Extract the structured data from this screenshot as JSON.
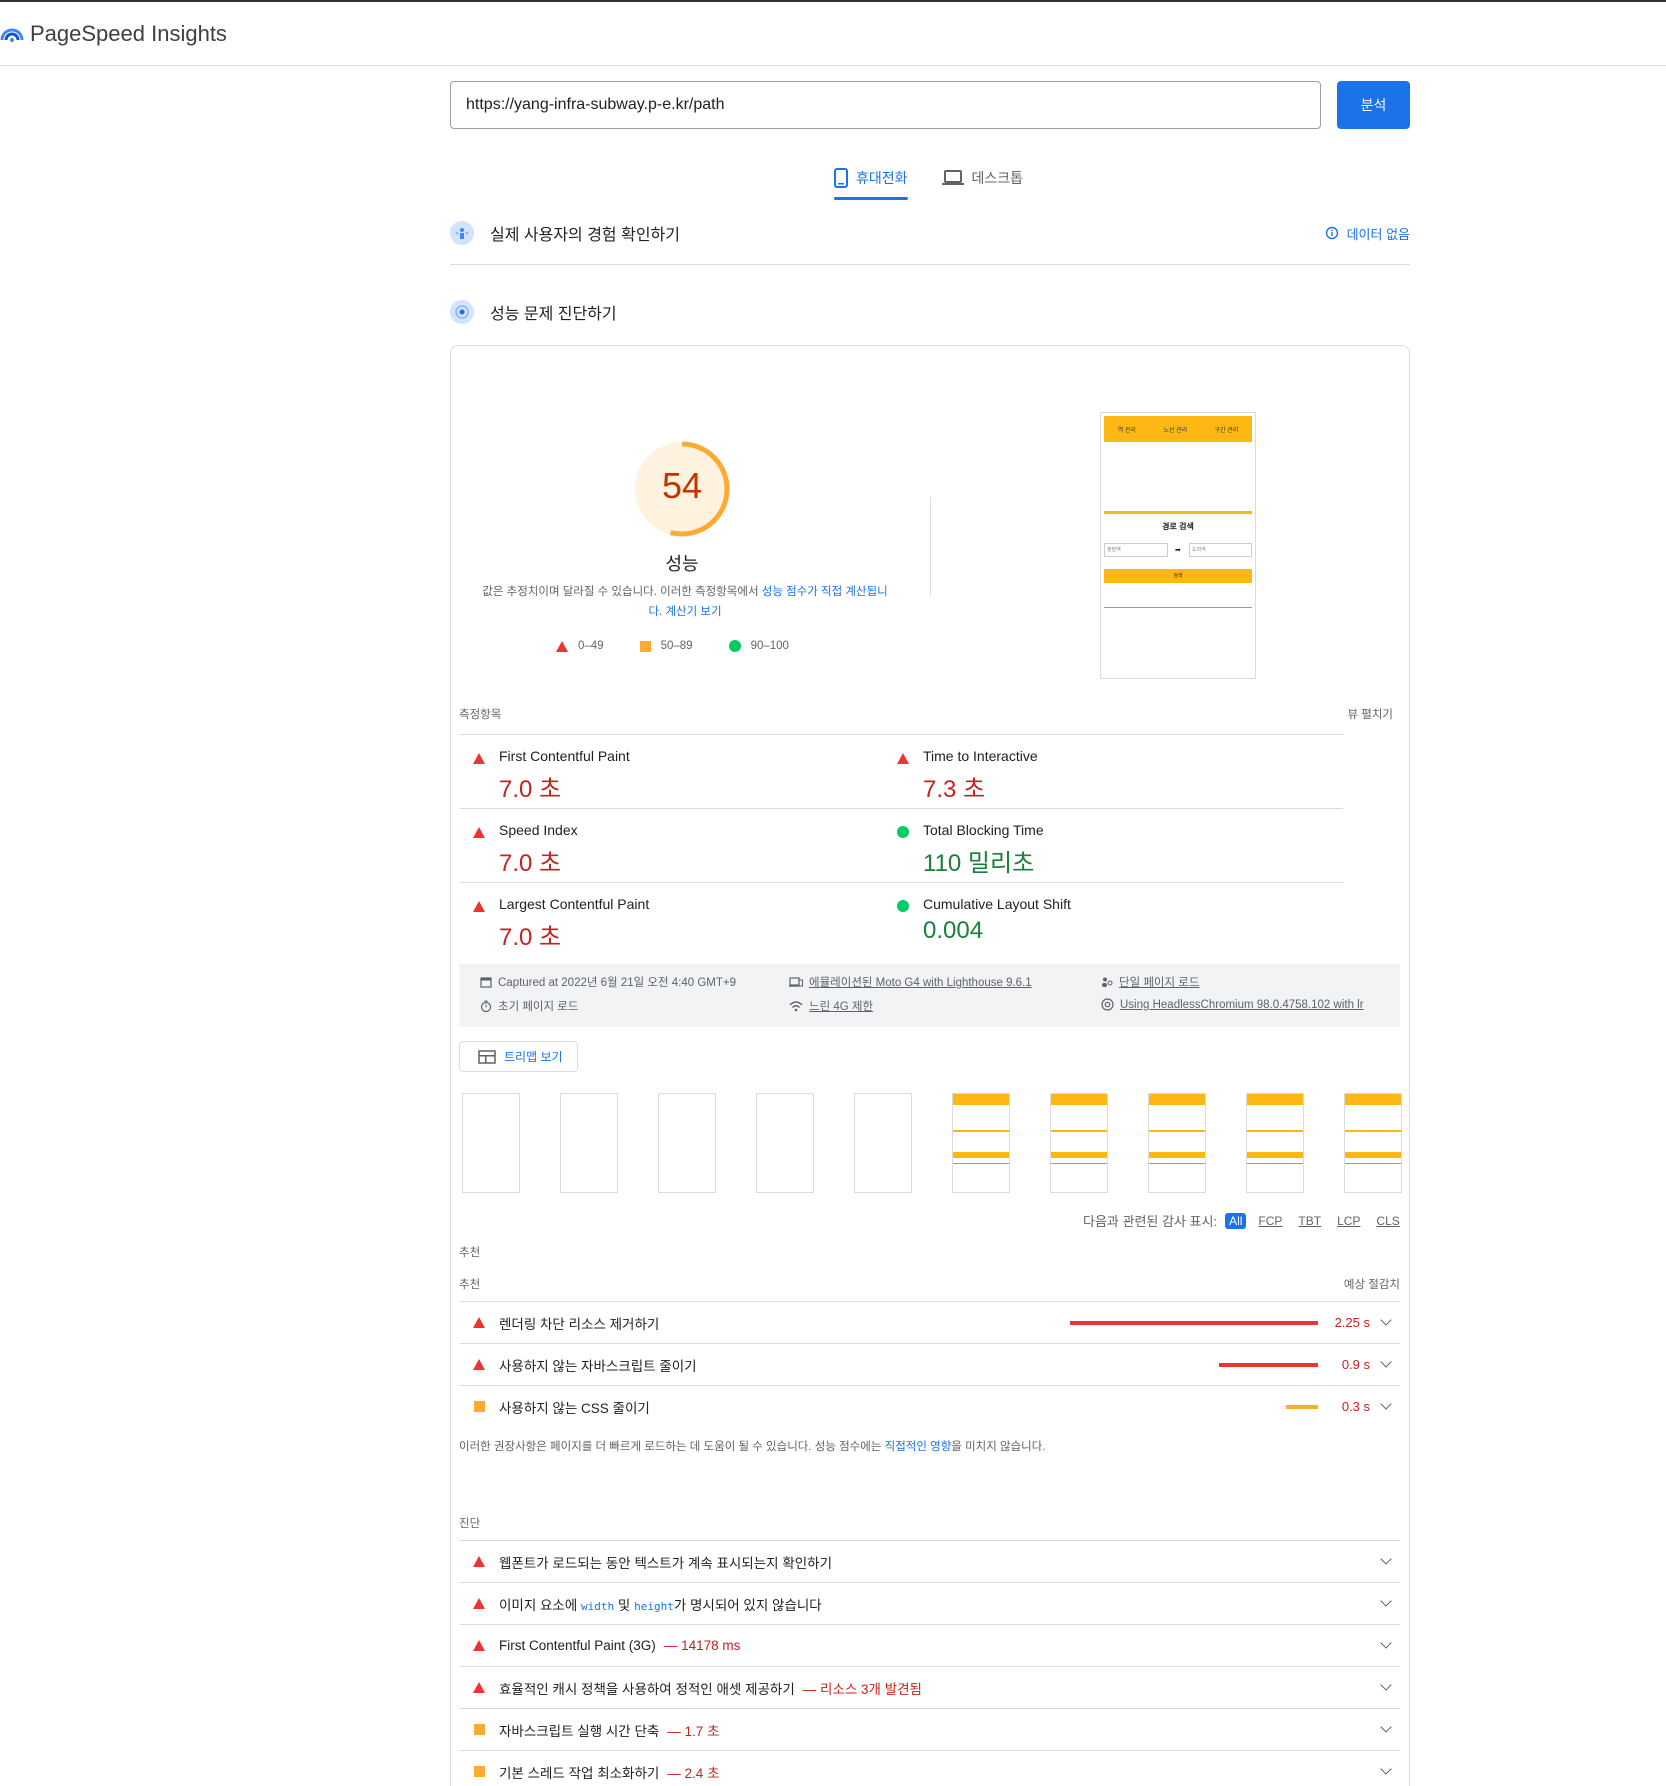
{
  "header": {
    "brand": "PageSpeed Insights"
  },
  "search": {
    "url": "https://yang-infra-subway.p-e.kr/path",
    "analyze_label": "분석"
  },
  "tabs": [
    {
      "label": "휴대전화",
      "active": true
    },
    {
      "label": "데스크톱",
      "active": false
    }
  ],
  "field_data": {
    "title": "실제 사용자의 경험 확인하기",
    "no_data_label": "데이터 없음"
  },
  "diagnose": {
    "title": "성능 문제 진단하기"
  },
  "score": {
    "value": "54",
    "fraction": 0.54,
    "label": "성능",
    "note_prefix": "값은 추정치이며 달라질 수 있습니다. 이러한 측정항목에서 ",
    "note_link1": "성능 점수가 직접 계산됩니",
    "note_link1b": "다",
    "note_sep": ". ",
    "note_link2": "계산기 보기",
    "legend": [
      {
        "range": "0–49"
      },
      {
        "range": "50–89"
      },
      {
        "range": "90–100"
      }
    ],
    "color": "#fa3"
  },
  "screenshot": {
    "nav1": "역 관리",
    "nav2": "노선 관리",
    "nav3": "구간 관리",
    "heading": "경로 검색",
    "from": "출발역",
    "to": "도착역",
    "button": "검색"
  },
  "metrics": {
    "title": "측정항목",
    "expand_label": "뷰 펼치기",
    "items": [
      {
        "name": "First Contentful Paint",
        "value": "7.0 초",
        "status": "red"
      },
      {
        "name": "Time to Interactive",
        "value": "7.3 초",
        "status": "red"
      },
      {
        "name": "Speed Index",
        "value": "7.0 초",
        "status": "red"
      },
      {
        "name": "Total Blocking Time",
        "value": "110 밀리초",
        "status": "green"
      },
      {
        "name": "Largest Contentful Paint",
        "value": "7.0 초",
        "status": "red"
      },
      {
        "name": "Cumulative Layout Shift",
        "value": "0.004",
        "status": "green"
      }
    ]
  },
  "environment": {
    "captured": "Captured at 2022년 6월 21일 오전 4:40 GMT+9",
    "initial_load": "초기 페이지 로드",
    "device": "에뮬레이션된 Moto G4 with Lighthouse 9.6.1",
    "throttle": "느린 4G 제한",
    "single_load": "단일 페이지 로드",
    "browser": "Using HeadlessChromium 98.0.4758.102 with lr"
  },
  "treemap_label": "트리맵 보기",
  "filmstrip": {
    "blank_count": 5,
    "rendered_count": 5
  },
  "filter": {
    "label": "다음과 관련된 감사 표시:",
    "chips": [
      "All",
      "FCP",
      "TBT",
      "LCP",
      "CLS"
    ]
  },
  "opportunities": {
    "section_label": "추천",
    "header_left": "추천",
    "header_right": "예상 절감치",
    "items": [
      {
        "label": "렌더링 차단 리소스 제거하기",
        "value": "2.25 s",
        "status": "red",
        "color": "#e33",
        "fraction": 1.0
      },
      {
        "label": "사용하지 않는 자바스크립트 줄이기",
        "value": "0.9 s",
        "status": "red",
        "color": "#e33",
        "fraction": 0.4
      },
      {
        "label": "사용하지 않는 CSS 줄이기",
        "value": "0.3 s",
        "status": "orange",
        "color": "#fa3",
        "fraction": 0.13
      }
    ],
    "note_prefix": "이러한 권장사항은 페이지를 더 빠르게 로드하는 데 도움이 될 수 있습니다. 성능 점수에는 ",
    "note_link": "직접적인 영향",
    "note_suffix": "을 미치지 않습니다."
  },
  "diagnostics": {
    "section_label": "진단",
    "items": [
      {
        "label": "웹폰트가 로드되는 동안 텍스트가 계속 표시되는지 확인하기",
        "extra": "",
        "status": "red"
      },
      {
        "label_pre": "이미지 요소에 ",
        "code1": "width",
        "label_mid": " 및 ",
        "code2": "height",
        "label_post": "가 명시되어 있지 않습니다",
        "status": "red"
      },
      {
        "label": "First Contentful Paint (3G)",
        "extra": "— 14178 ms",
        "status": "red"
      },
      {
        "label": "효율적인 캐시 정책을 사용하여 정적인 애셋 제공하기",
        "extra": "— 리소스 3개 발견됨",
        "status": "red"
      },
      {
        "label": "자바스크립트 실행 시간 단축",
        "extra": "— 1.7 초",
        "status": "orange"
      },
      {
        "label": "기본 스레드 작업 최소화하기",
        "extra": "— 2.4 초",
        "status": "orange"
      }
    ]
  }
}
